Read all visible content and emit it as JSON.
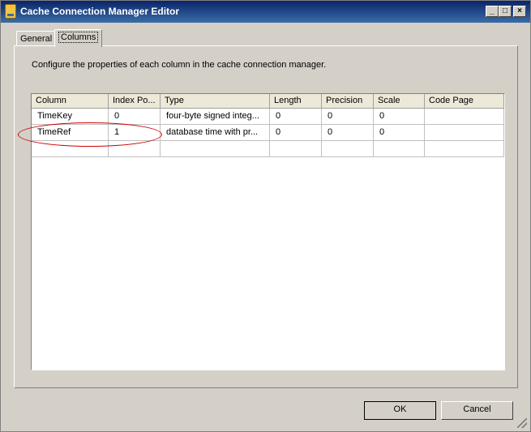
{
  "window": {
    "title": "Cache Connection Manager Editor"
  },
  "tabs": [
    {
      "label": "General",
      "active": false
    },
    {
      "label": "Columns",
      "active": true
    }
  ],
  "description": "Configure the properties of each column in the cache connection manager.",
  "grid": {
    "headers": [
      "Column",
      "Index Po...",
      "Type",
      "Length",
      "Precision",
      "Scale",
      "Code Page"
    ],
    "rows": [
      [
        "TimeKey",
        "0",
        "four-byte signed integ...",
        "0",
        "0",
        "0",
        ""
      ],
      [
        "TimeRef",
        "1",
        "database time with pr...",
        "0",
        "0",
        "0",
        ""
      ]
    ]
  },
  "buttons": {
    "ok": "OK",
    "cancel": "Cancel"
  },
  "colors": {
    "titlebar_start": "#0a246a",
    "titlebar_end": "#3a6ea5",
    "highlight_ellipse": "#cc0000"
  }
}
